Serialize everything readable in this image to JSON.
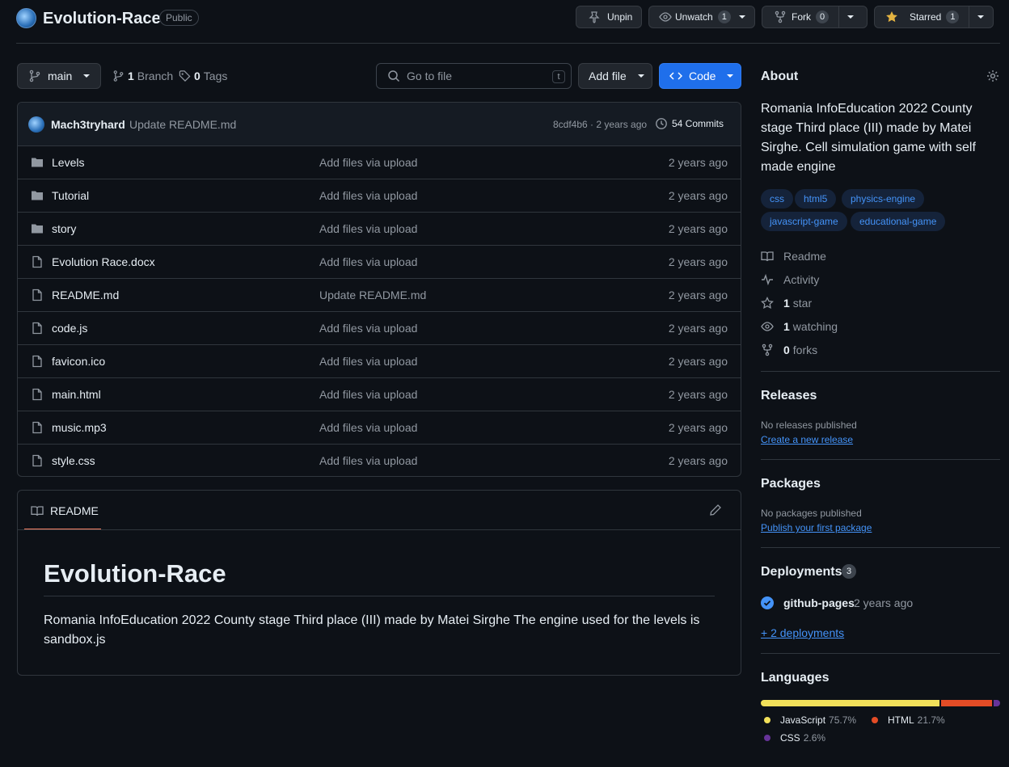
{
  "repo": {
    "name": "Evolution-Race",
    "visibility": "Public"
  },
  "actions": {
    "unpin": "Unpin",
    "unwatch": "Unwatch",
    "watch_count": "1",
    "fork": "Fork",
    "fork_count": "0",
    "starred": "Starred",
    "star_count": "1"
  },
  "toolbar": {
    "branch": "main",
    "branches_count": "1",
    "branches_label": "Branch",
    "tags_count": "0",
    "tags_label": "Tags",
    "goto_placeholder": "Go to file",
    "goto_shortcut": "t",
    "add_file": "Add file",
    "code": "Code"
  },
  "commit": {
    "author": "Mach3tryhard",
    "message": "Update README.md",
    "hash_time": "8cdf4b6 · 2 years ago",
    "commits": "54 Commits"
  },
  "files": [
    {
      "type": "folder",
      "name": "Levels",
      "message": "Add files via upload",
      "time": "2 years ago"
    },
    {
      "type": "folder",
      "name": "Tutorial",
      "message": "Add files via upload",
      "time": "2 years ago"
    },
    {
      "type": "folder",
      "name": "story",
      "message": "Add files via upload",
      "time": "2 years ago"
    },
    {
      "type": "file",
      "name": "Evolution Race.docx",
      "message": "Add files via upload",
      "time": "2 years ago"
    },
    {
      "type": "file",
      "name": "README.md",
      "message": "Update README.md",
      "time": "2 years ago"
    },
    {
      "type": "file",
      "name": "code.js",
      "message": "Add files via upload",
      "time": "2 years ago"
    },
    {
      "type": "file",
      "name": "favicon.ico",
      "message": "Add files via upload",
      "time": "2 years ago"
    },
    {
      "type": "file",
      "name": "main.html",
      "message": "Add files via upload",
      "time": "2 years ago"
    },
    {
      "type": "file",
      "name": "music.mp3",
      "message": "Add files via upload",
      "time": "2 years ago"
    },
    {
      "type": "file",
      "name": "style.css",
      "message": "Add files via upload",
      "time": "2 years ago"
    }
  ],
  "readme": {
    "tab": "README",
    "title": "Evolution-Race",
    "body": "Romania InfoEducation 2022 County stage Third place (III) made by Matei Sirghe The engine used for the levels is sandbox.js"
  },
  "about": {
    "heading": "About",
    "description": "Romania InfoEducation 2022 County stage Third place (III) made by Matei Sirghe. Cell simulation game with self made engine",
    "topics": [
      "css",
      "html5",
      "physics-engine",
      "javascript-game",
      "educational-game"
    ],
    "readme": "Readme",
    "activity": "Activity",
    "stars_count": "1",
    "stars_label": "star",
    "watching_count": "1",
    "watching_label": "watching",
    "forks_count": "0",
    "forks_label": "forks"
  },
  "releases": {
    "heading": "Releases",
    "empty": "No releases published",
    "link": "Create a new release"
  },
  "packages": {
    "heading": "Packages",
    "empty": "No packages published",
    "link": "Publish your first package"
  },
  "deployments": {
    "heading": "Deployments",
    "count": "3",
    "env": "github-pages",
    "time": "2 years ago",
    "more": "+ 2 deployments"
  },
  "languages": {
    "heading": "Languages",
    "items": [
      {
        "name": "JavaScript",
        "percent": "75.7%",
        "value": 75.7,
        "color": "#f1e05a"
      },
      {
        "name": "HTML",
        "percent": "21.7%",
        "value": 21.7,
        "color": "#e34c26"
      },
      {
        "name": "CSS",
        "percent": "2.6%",
        "value": 2.6,
        "color": "#663399"
      }
    ]
  },
  "colors": {
    "accent": "#238636",
    "code_button": "#1f6feb",
    "link": "#4493f8"
  }
}
